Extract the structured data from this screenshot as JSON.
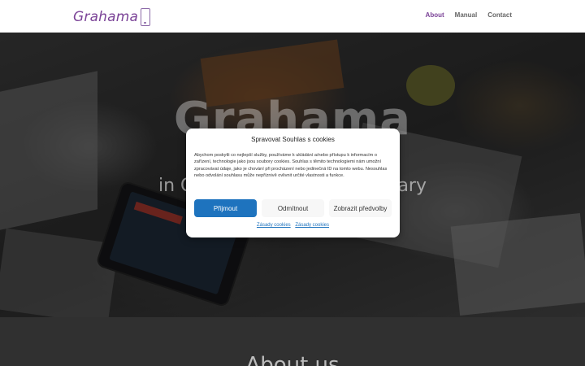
{
  "header": {
    "logo_text": "Grahama",
    "nav": [
      {
        "label": "About",
        "active": true
      },
      {
        "label": "Manual",
        "active": false
      },
      {
        "label": "Contact",
        "active": false
      }
    ]
  },
  "hero": {
    "title": "Grahama",
    "subtitle_left": "in C",
    "subtitle_right": "gary"
  },
  "about": {
    "title": "About us"
  },
  "cookie_modal": {
    "title": "Spravovat Souhlas s cookies",
    "text": "Abychom poskytli co nejlepší služby, používáme k ukládání a/nebo přístupu k informacím o zařízení, technologie jako jsou soubory cookies. Souhlas s těmito technologiemi nám umožní zpracovávat údaje, jako je chování při procházení nebo jedinečná ID na tomto webu. Nesouhlas nebo odvolání souhlasu může nepříznivě ovlivnit určité vlastnosti a funkce.",
    "accept_label": "Přijmout",
    "deny_label": "Odmítnout",
    "preferences_label": "Zobrazit předvolby",
    "links": [
      "Zásady cookies",
      "Zásady cookies"
    ]
  },
  "colors": {
    "brand": "#7b4397",
    "accept_button": "#1e73be",
    "link": "#1e73be"
  }
}
